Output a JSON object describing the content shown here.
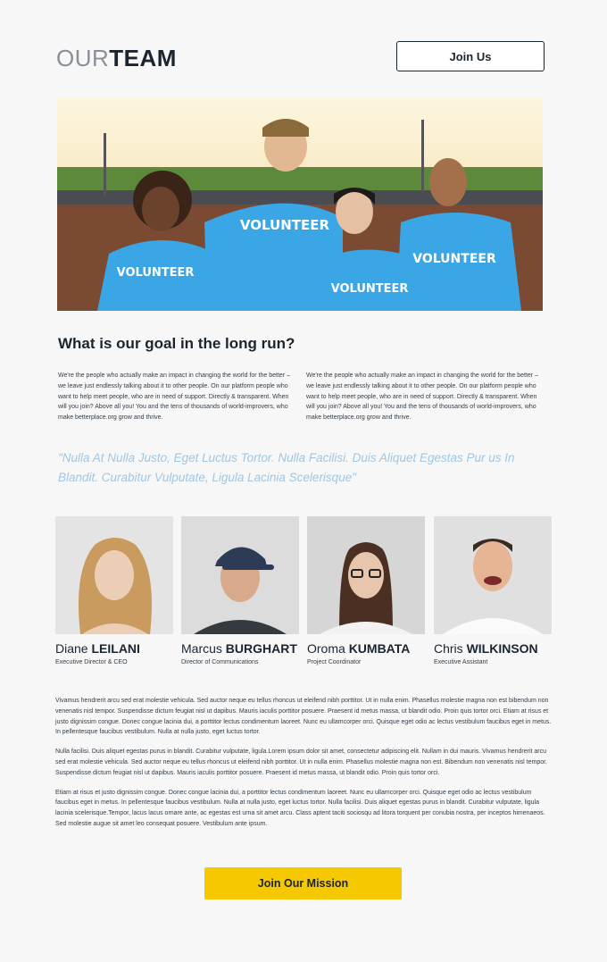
{
  "header": {
    "title_light": "OUR",
    "title_bold": "TEAM",
    "join_label": "Join Us"
  },
  "hero": {
    "shirt_text": "VOLUNTEER"
  },
  "goal": {
    "title": "What is our goal in the long run?",
    "left_text": "We're the people who actually make an impact in changing the world for the better – we leave just endlessly talking about it to other people. On our platform people who want to help meet people, who are in need of support. Directly & transparent. When will you join? Above all you! You and the tens of thousands of world-improvers, who make betterplace.org grow and thrive.",
    "right_text": "We're the people who actually make an impact in changing the world for the better – we leave just endlessly talking about it to other people. On our platform people who want to help meet people, who are in need of support. Directly & transparent. When will you join? Above all you! You and the tens of thousands of world-improvers, who make betterplace.org grow and thrive."
  },
  "quote": "\"Nulla At Nulla Justo, Eget Luctus Tortor. Nulla Facilisi. Duis Aliquet Egestas Pur us In Blandit. Curabitur Vulputate, Ligula Lacinia Scelerisque\"",
  "team": [
    {
      "first": "Diane",
      "last": "LEILANI",
      "role": "Executive Director & CEO"
    },
    {
      "first": "Marcus",
      "last": "BURGHART",
      "role": "Director of Communications"
    },
    {
      "first": "Oroma",
      "last": "KUMBATA",
      "role": "Project Coordinator"
    },
    {
      "first": "Chris",
      "last": "WILKINSON",
      "role": "Executive Assistant"
    }
  ],
  "body": {
    "p1": "Vivamus hendrerit arcu sed erat molestie vehicula. Sed auctor neque eu tellus rhoncus ut eleifend nibh porttitor. Ut in nulla enim. Phasellus molestie magna non est bibendum non venenatis nisl tempor. Suspendisse dictum feugiat nisl ut dapibus. Mauris iaculis porttitor posuere. Praesent id metus massa, ut blandit odio. Proin quis tortor orci. Etiam at risus et justo dignissim congue. Donec congue lacinia dui, a porttitor lectus condimentum laoreet. Nunc eu ullamcorper orci. Quisque eget odio ac lectus vestibulum faucibus eget in metus. In pellentesque faucibus vestibulum. Nulla at nulla justo, eget luctus tortor.",
    "p2": "Nulla facilisi. Duis aliquet egestas purus in blandit. Curabitur vulputate, ligula.Lorem ipsum dolor sit amet, consectetur adipiscing elit. Nullam in dui mauris. Vivamus hendrerit arcu sed erat molestie vehicula. Sed auctor neque eu tellus rhoncus ut eleifend nibh porttitor. Ut in nulla enim. Phasellus molestie magna non est. Bibendum non venenatis nisl tempor. Suspendisse dictum feugiat nisl ut dapibus. Mauris iaculis porttitor posuere. Praesent id metus massa, ut blandit odio. Proin quis tortor orci.",
    "p3": "Etiam at risus et justo dignissim congue. Donec congue lacinia dui, a porttitor lectus condimentum laoreet. Nunc eu ullamcorper orci. Quisque eget odio ac lectus vestibulum faucibus eget in metus. In pellentesque faucibus vestibulum. Nulla at nulla justo, eget luctus tortor. Nulla facilisi. Duis aliquet egestas purus in blandit. Curabitur vulputate, ligula lacinia scelerisque.Tempor, lacus lacus ornare ante, ac egestas est urna sit amet arcu. Class aptent taciti sociosqu ad litora torquent per conubia nostra, per inceptos himenaeos. Sed molestie augue sit amet leo consequat posuere. Vestibulum ante ipsum."
  },
  "mission_label": "Join Our Mission",
  "colors": {
    "accent_yellow": "#f5c800",
    "quote_blue": "#9ec7e3",
    "navy": "#1a2530",
    "shirt_blue": "#3aa6e6"
  }
}
